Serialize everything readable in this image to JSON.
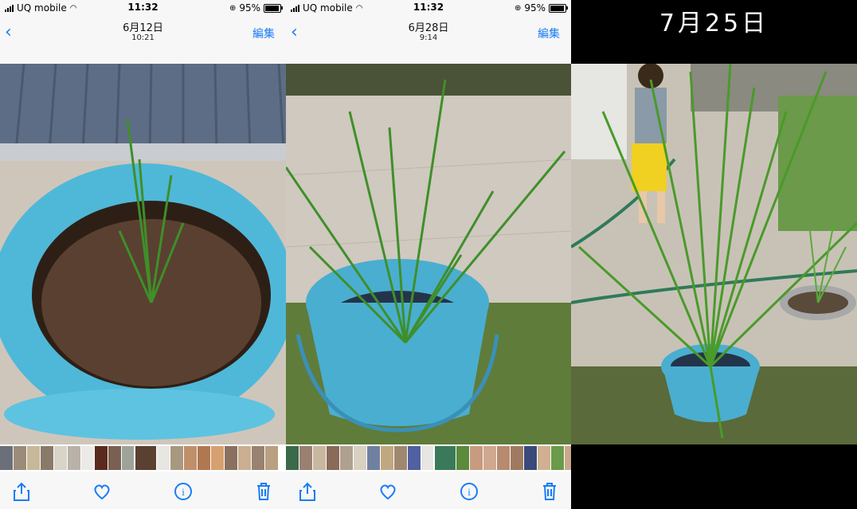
{
  "panels": [
    {
      "status": {
        "carrier": "UQ mobile",
        "time": "11:32",
        "battery": "95%"
      },
      "nav": {
        "date": "6月12日",
        "time": "10:21",
        "edit": "編集"
      }
    },
    {
      "status": {
        "carrier": "UQ mobile",
        "time": "11:32",
        "battery": "95%"
      },
      "nav": {
        "date": "6月28日",
        "time": "9:14",
        "edit": "編集"
      }
    },
    {
      "title": "7月25日"
    }
  ],
  "icons": {
    "back": "chevron-left-icon",
    "share": "share-icon",
    "favorite": "heart-icon",
    "info": "info-icon",
    "delete": "trash-icon"
  },
  "colors": {
    "accent": "#1a7cf5",
    "bucket": "#4fb8d8",
    "mud": "#5a4030",
    "plant": "#3f8f2a"
  },
  "battery_level": 0.95
}
